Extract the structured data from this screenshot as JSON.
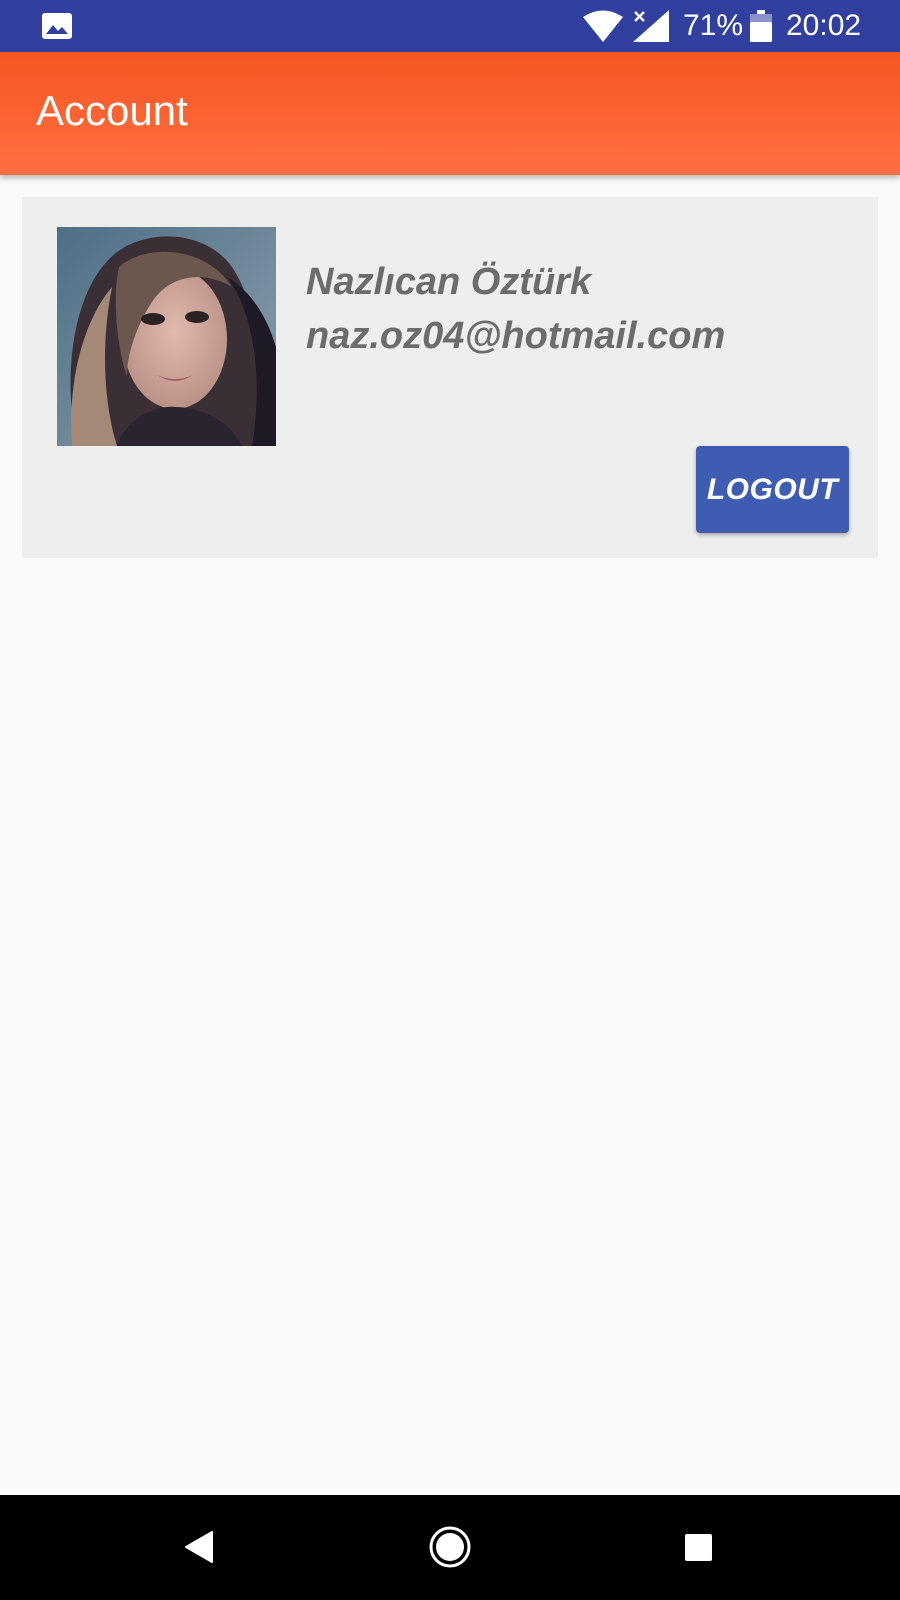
{
  "status_bar": {
    "battery_percent": "71%",
    "time": "20:02",
    "icons": [
      "gallery-icon",
      "wifi-icon",
      "signal-icon",
      "battery-icon"
    ]
  },
  "app_bar": {
    "title": "Account",
    "gradient_colors": [
      "#f5561f",
      "#ff6f43"
    ]
  },
  "account_card": {
    "name": "Nazlıcan Öztürk",
    "email": "naz.oz04@hotmail.com",
    "logout_label": "LOGOUT"
  },
  "navigation_bar": {
    "icons": [
      "back-icon",
      "home-icon",
      "recents-icon"
    ]
  },
  "colors": {
    "status_bar": "#31409f",
    "accent_button": "#3f5cb3",
    "card_background": "#eeeeee",
    "text_secondary": "#6c6c6c"
  }
}
